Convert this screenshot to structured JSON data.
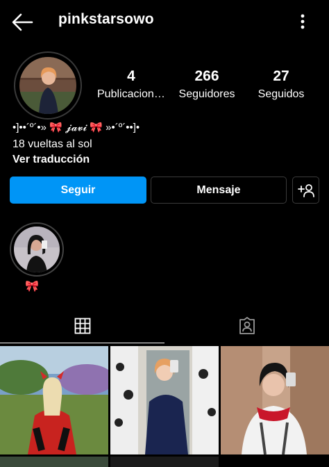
{
  "header": {
    "username": "pinkstarsowo",
    "back_icon": "arrow-left-icon",
    "more_icon": "more-vertical-icon"
  },
  "profile": {
    "stats": [
      {
        "value": "4",
        "label": "Publicaciones"
      },
      {
        "value": "266",
        "label": "Seguidores"
      },
      {
        "value": "27",
        "label": "Seguidos"
      }
    ],
    "bio": {
      "name": "•]••´º´•» 🎀 𝓳𝓪𝓿𝓲 🎀 »•´º´••]•",
      "text": "18 vueltas al sol",
      "translate": "Ver traducción"
    }
  },
  "actions": {
    "follow": "Seguir",
    "message": "Mensaje",
    "suggest_icon": "add-person-icon"
  },
  "highlights": [
    {
      "label": "🎀"
    }
  ],
  "tabs": [
    {
      "name": "posts-grid",
      "icon": "grid-icon",
      "active": true
    },
    {
      "name": "tagged",
      "icon": "tagged-person-icon",
      "active": false
    }
  ],
  "colors": {
    "background": "#000000",
    "primary": "#0095f6",
    "border": "#3b3b3b"
  }
}
